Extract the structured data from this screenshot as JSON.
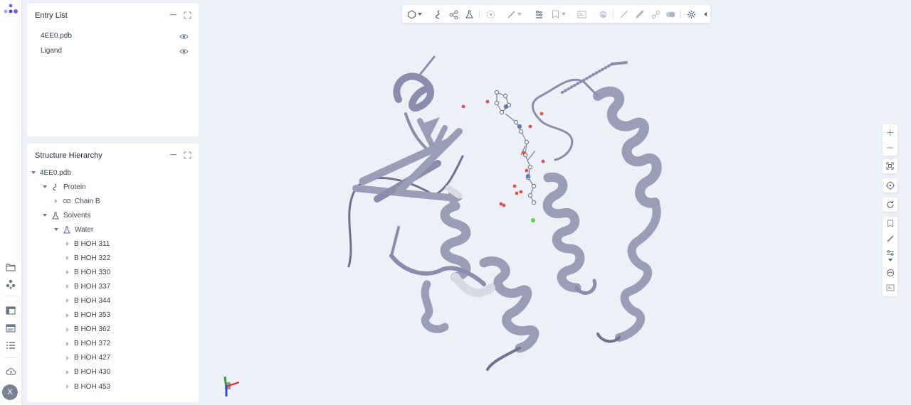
{
  "entry_list": {
    "title": "Entry List",
    "items": [
      {
        "label": "4EE0.pdb",
        "visible": true
      },
      {
        "label": "Ligand",
        "visible": true
      }
    ]
  },
  "structure_hierarchy": {
    "title": "Structure Hierarchy",
    "root": "4EE0.pdb",
    "protein": "Protein",
    "chain": "Chain B",
    "solvents": "Solvents",
    "water": "Water",
    "residues": [
      "B HOH 311",
      "B HOH 322",
      "B HOH 330",
      "B HOH 337",
      "B HOH 344",
      "B HOH 353",
      "B HOH 362",
      "B HOH 372",
      "B HOH 427",
      "B HOH 430",
      "B HOH 453"
    ]
  },
  "user": {
    "avatar_initial": "X"
  },
  "colors": {
    "background": "#eef0f8",
    "ribbon": "#9a9db6",
    "ribbon_dark": "#6e7190",
    "accent": "#4a4fd6",
    "water": "#d9534f",
    "ion": "#5cd13a"
  }
}
